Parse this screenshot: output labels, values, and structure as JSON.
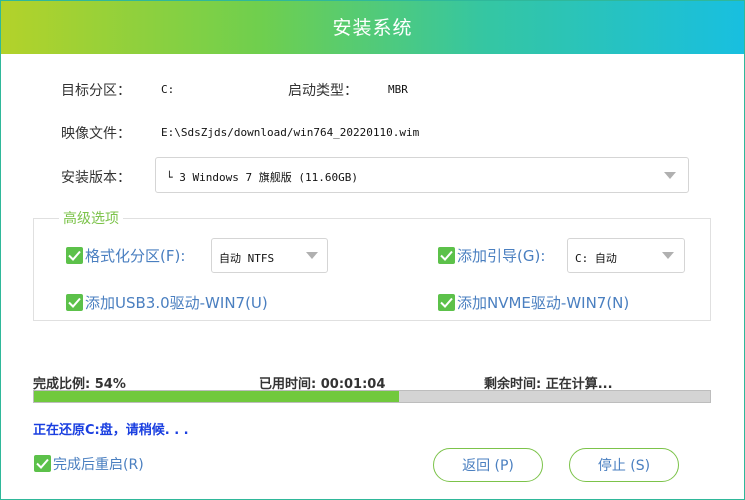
{
  "window": {
    "title": "安装系统"
  },
  "info": {
    "target_partition_label": "目标分区：",
    "target_partition_value": "C:",
    "boot_type_label": "启动类型：",
    "boot_type_value": "MBR",
    "image_file_label": "映像文件：",
    "image_file_value": "E:\\SdsZjds/download/win764_20220110.wim",
    "version_label": "安装版本：",
    "version_value": "└ 3 Windows 7 旗舰版 (11.60GB)"
  },
  "advanced": {
    "title": "高级选项",
    "format": {
      "label": "格式化分区(F):",
      "checked": true,
      "select_value": "自动 NTFS"
    },
    "boot": {
      "label": "添加引导(G):",
      "checked": true,
      "select_value": "C: 自动"
    },
    "usb3": {
      "label": "添加USB3.0驱动-WIN7(U)",
      "checked": true
    },
    "nvme": {
      "label": "添加NVME驱动-WIN7(N)",
      "checked": true
    }
  },
  "progress": {
    "ratio_text": "完成比例: 54%",
    "elapsed_text": "已用时间: 00:01:04",
    "remaining_text": "剩余时间: 正在计算...",
    "percent": 54,
    "status_text": "正在还原C:盘，请稍候. . ."
  },
  "footer": {
    "restart_label": "完成后重启(R)",
    "restart_checked": true,
    "back_button": "返回 (P)",
    "stop_button": "停止 (S)"
  },
  "colors": {
    "accent_green": "#71c93d",
    "checkbox_green": "#5cc14a",
    "option_text_blue": "#4a7fc0",
    "status_blue": "#1a3fe0",
    "title_gradient_start": "#b3d22a",
    "title_gradient_end": "#18bfe0"
  }
}
